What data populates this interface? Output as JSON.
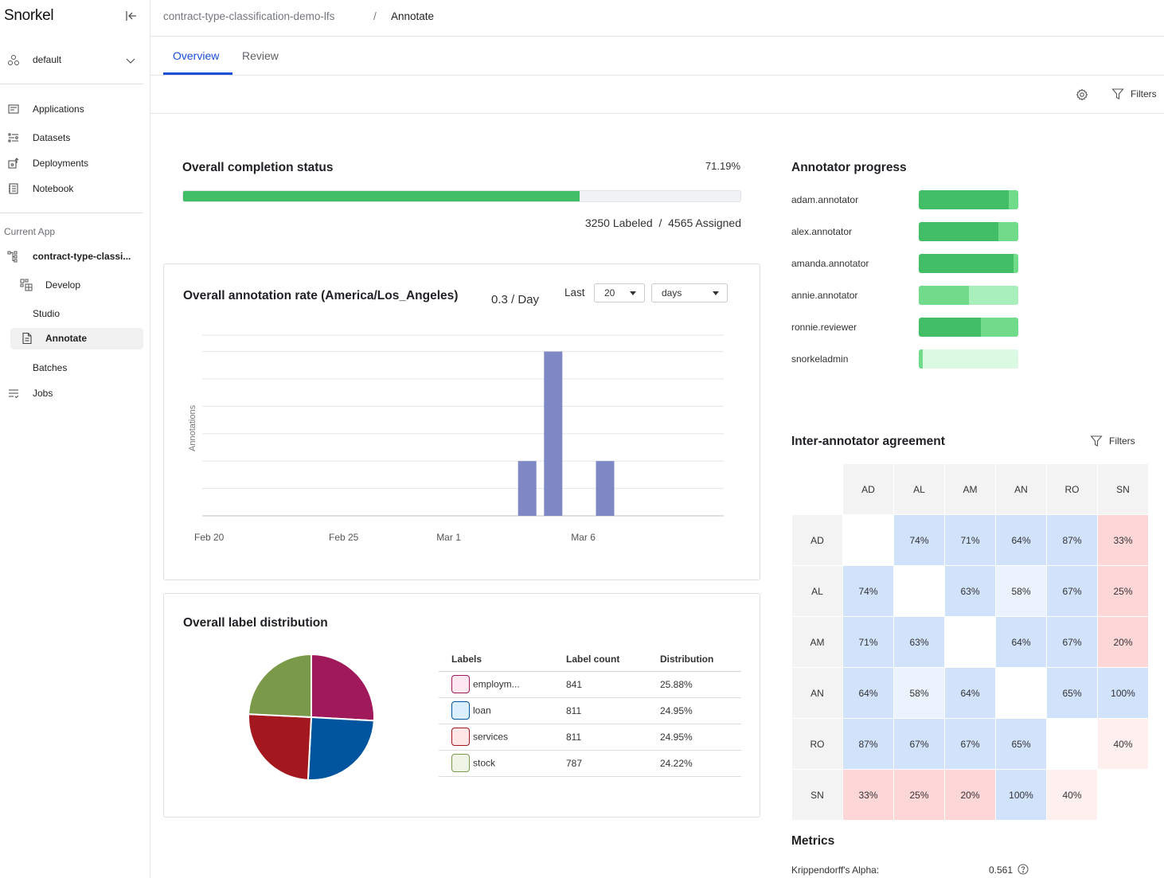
{
  "app": {
    "logo": "Snorkel"
  },
  "sidebar": {
    "workspace": "default",
    "nav": [
      {
        "label": "Applications",
        "icon": "applications-icon"
      },
      {
        "label": "Datasets",
        "icon": "datasets-icon"
      },
      {
        "label": "Deployments",
        "icon": "deployments-icon"
      },
      {
        "label": "Notebook",
        "icon": "notebook-icon"
      }
    ],
    "current_app_label": "Current App",
    "current_app": "contract-type-classi...",
    "app_items": [
      {
        "label": "Develop",
        "icon": "develop-icon"
      },
      {
        "label": "Studio"
      },
      {
        "label": "Annotate",
        "icon": "annotate-icon",
        "active": true
      },
      {
        "label": "Batches"
      },
      {
        "label": "Jobs",
        "icon": "jobs-icon"
      }
    ]
  },
  "header": {
    "breadcrumb_app": "contract-type-classification-demo-lfs",
    "breadcrumb_sep": "/",
    "breadcrumb_current": "Annotate",
    "tabs": [
      {
        "label": "Overview",
        "active": true
      },
      {
        "label": "Review",
        "active": false
      }
    ],
    "filters_label": "Filters"
  },
  "completion": {
    "title": "Overall completion status",
    "percent_label": "71.19%",
    "percent": 71.19,
    "labeled": 3250,
    "assigned": 4565,
    "counts_label": "3250 Labeled  /  4565 Assigned"
  },
  "annotation_rate": {
    "title": "Overall annotation rate (America/Los_Angeles)",
    "rate": "0.3 / Day",
    "last_label": "Last",
    "range_value": "20",
    "range_unit": "days"
  },
  "label_distribution": {
    "title": "Overall label distribution",
    "columns": [
      "Labels",
      "Label count",
      "Distribution"
    ],
    "rows": [
      {
        "label": "employm...",
        "count": "841",
        "distribution": "25.88%",
        "color": "#a0195a",
        "bg": "#fde7f1"
      },
      {
        "label": "loan",
        "count": "811",
        "distribution": "24.95%",
        "color": "#00559e",
        "bg": "#dcefff"
      },
      {
        "label": "services",
        "count": "811",
        "distribution": "24.95%",
        "color": "#a3171e",
        "bg": "#ffe6e6"
      },
      {
        "label": "stock",
        "count": "787",
        "distribution": "24.22%",
        "color": "#7a9a4a",
        "bg": "#eef4e6"
      }
    ]
  },
  "annotator_progress": {
    "title": "Annotator progress",
    "annotators": [
      {
        "name": "adam.annotator",
        "segments": [
          0.9,
          0.1,
          0
        ]
      },
      {
        "name": "alex.annotator",
        "segments": [
          0.8,
          0.2,
          0
        ]
      },
      {
        "name": "amanda.annotator",
        "segments": [
          0.95,
          0.05,
          0
        ]
      },
      {
        "name": "annie.annotator",
        "segments": [
          0,
          0.5,
          0.5
        ]
      },
      {
        "name": "ronnie.reviewer",
        "segments": [
          0.625,
          0.375,
          0
        ]
      },
      {
        "name": "snorkeladmin",
        "segments": [
          0,
          0.04,
          0.96
        ]
      }
    ],
    "colors": [
      "#42bf66",
      "#6fdb8b",
      "#a8efbb"
    ],
    "empty_color": "#dcf9e3"
  },
  "iaa": {
    "title": "Inter-annotator agreement",
    "filters_label": "Filters",
    "headers": [
      "AD",
      "AL",
      "AM",
      "AN",
      "RO",
      "SN"
    ],
    "matrix": [
      [
        null,
        "74%",
        "71%",
        "64%",
        "87%",
        "33%"
      ],
      [
        "74%",
        null,
        "63%",
        "58%",
        "67%",
        "25%"
      ],
      [
        "71%",
        "63%",
        null,
        "64%",
        "67%",
        "20%"
      ],
      [
        "64%",
        "58%",
        "64%",
        null,
        "65%",
        "100%"
      ],
      [
        "87%",
        "67%",
        "67%",
        "65%",
        null,
        "40%"
      ],
      [
        "33%",
        "25%",
        "20%",
        "100%",
        "40%",
        null
      ]
    ]
  },
  "metrics": {
    "title": "Metrics",
    "krippendorff_label": "Krippendorff's Alpha:",
    "krippendorff_value": "0.561"
  },
  "chart_data": [
    {
      "type": "bar",
      "title": "Overall annotation rate (America/Los_Angeles)",
      "xlabel": "",
      "ylabel": "Annotations",
      "x_ticks": [
        "Feb 20",
        "Feb 25",
        "Mar 1",
        "Mar 6"
      ],
      "categories": [
        "Feb 20",
        "Feb 21",
        "Feb 22",
        "Feb 23",
        "Feb 24",
        "Feb 25",
        "Feb 26",
        "Feb 27",
        "Feb 28",
        "Mar 1",
        "Mar 2",
        "Mar 3",
        "Mar 4",
        "Mar 5",
        "Mar 6",
        "Mar 7",
        "Mar 8",
        "Mar 9",
        "Mar 10"
      ],
      "values": [
        0,
        0,
        0,
        0,
        0,
        0,
        0,
        0,
        0,
        0,
        0,
        0,
        2,
        6,
        0,
        2,
        0,
        0,
        0
      ],
      "ylim": [
        0,
        6.6
      ],
      "grid": true,
      "color": "#7f88c4"
    },
    {
      "type": "pie",
      "title": "Overall label distribution",
      "labels": [
        "employment",
        "loan",
        "services",
        "stock"
      ],
      "values": [
        841,
        811,
        811,
        787
      ],
      "colors": [
        "#a0195a",
        "#00559e",
        "#a3171e",
        "#7a9a4a"
      ]
    }
  ]
}
